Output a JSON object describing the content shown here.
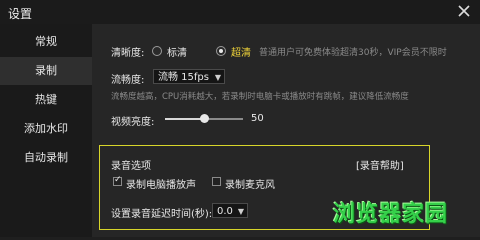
{
  "window": {
    "title": "设置"
  },
  "sidebar": {
    "items": [
      {
        "label": "常规"
      },
      {
        "label": "录制"
      },
      {
        "label": "热键"
      },
      {
        "label": "添加水印"
      },
      {
        "label": "自动录制"
      }
    ],
    "active_index": 1
  },
  "quality": {
    "label": "清晰度:",
    "options": [
      {
        "label": "标清",
        "selected": false
      },
      {
        "label": "超清",
        "selected": true
      }
    ],
    "note": "普通用户可免费体验超清30秒，VIP会员不限时"
  },
  "fluency": {
    "label": "流畅度:",
    "value": "流畅 15fps",
    "hint": "流畅度越高，CPU消耗越大，若录制时电脑卡或播放时有跳帧，建议降低流畅度"
  },
  "brightness": {
    "label": "视频亮度:",
    "value": 50,
    "level_fraction": 0.5
  },
  "audio": {
    "title": "录音选项",
    "help": "[录音帮助]",
    "record_system": {
      "label": "录制电脑播放声",
      "checked": true
    },
    "record_mic": {
      "label": "录制麦克风",
      "checked": false
    },
    "delay_label": "设置录音延迟时间(秒):",
    "delay_value": "0.0"
  },
  "watermark": {
    "text": "浏览器家园"
  },
  "colors": {
    "accent": "#d7d52a",
    "watermark": "#35d04a"
  }
}
